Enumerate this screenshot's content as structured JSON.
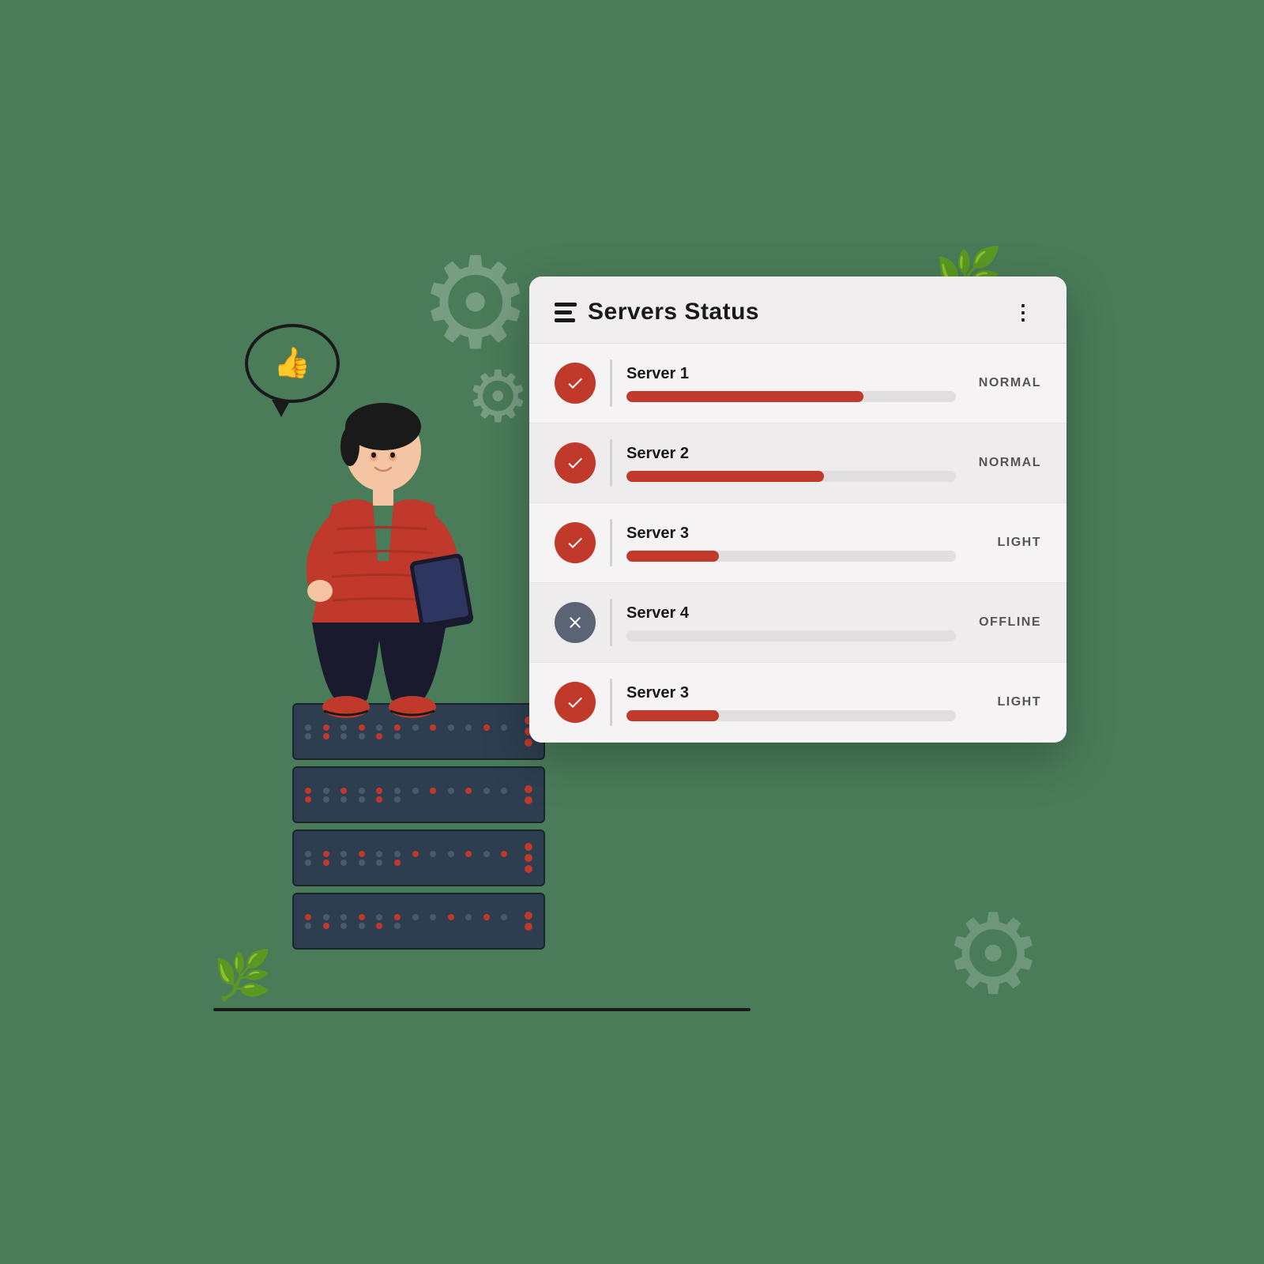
{
  "background_color": "#4a7c59",
  "card": {
    "title": "Servers Status",
    "more_button_label": "⋮"
  },
  "servers": [
    {
      "id": 1,
      "name": "Server 1",
      "status": "NORMAL",
      "online": true,
      "progress": 72
    },
    {
      "id": 2,
      "name": "Server 2",
      "status": "NORMAL",
      "online": true,
      "progress": 60
    },
    {
      "id": 3,
      "name": "Server 3",
      "status": "LIGHT",
      "online": true,
      "progress": 28
    },
    {
      "id": 4,
      "name": "Server 4",
      "status": "OFFLINE",
      "online": false,
      "progress": 0
    },
    {
      "id": 5,
      "name": "Server 3",
      "status": "LIGHT",
      "online": true,
      "progress": 28
    }
  ],
  "icons": {
    "check": "check-icon",
    "cross": "cross-icon",
    "list": "list-icon",
    "more": "more-icon",
    "gear": "gear-icon",
    "plant": "plant-icon",
    "thumb": "thumb-up-icon",
    "leaf": "leaf-icon"
  }
}
